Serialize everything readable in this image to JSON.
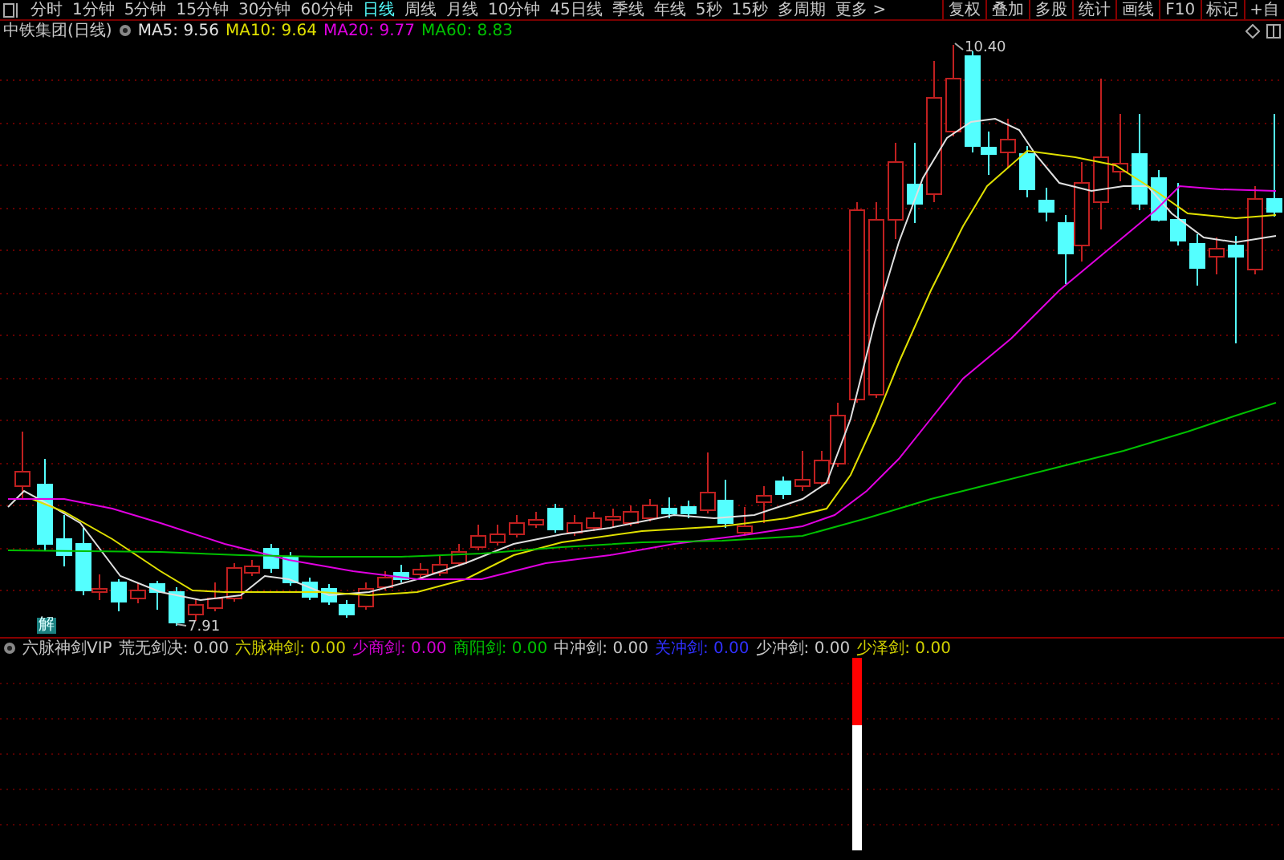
{
  "toolbar": {
    "periods": [
      {
        "label": "分时",
        "selected": false
      },
      {
        "label": "1分钟",
        "selected": false
      },
      {
        "label": "5分钟",
        "selected": false
      },
      {
        "label": "15分钟",
        "selected": false
      },
      {
        "label": "30分钟",
        "selected": false
      },
      {
        "label": "60分钟",
        "selected": false
      },
      {
        "label": "日线",
        "selected": true
      },
      {
        "label": "周线",
        "selected": false
      },
      {
        "label": "月线",
        "selected": false
      },
      {
        "label": "10分钟",
        "selected": false
      },
      {
        "label": "45日线",
        "selected": false
      },
      {
        "label": "季线",
        "selected": false
      },
      {
        "label": "年线",
        "selected": false
      },
      {
        "label": "5秒",
        "selected": false
      },
      {
        "label": "15秒",
        "selected": false
      },
      {
        "label": "多周期",
        "selected": false
      },
      {
        "label": "更多 >",
        "selected": false
      }
    ],
    "buttons": [
      "复权",
      "叠加",
      "多股",
      "统计",
      "画线",
      "F10",
      "标记",
      "+自"
    ]
  },
  "legend": {
    "title": "中铁集团(日线)",
    "indicators": [
      {
        "label": "MA5: 9.56",
        "color": "#e0e0e0"
      },
      {
        "label": "MA10: 9.64",
        "color": "#e0e000"
      },
      {
        "label": "MA20: 9.77",
        "color": "#e000e0"
      },
      {
        "label": "MA60: 8.83",
        "color": "#00c000"
      }
    ]
  },
  "chart": {
    "high_label": "10.40",
    "low_label": "7.91",
    "badge": "解"
  },
  "indicator_panel": {
    "title": "六脉神剑VIP",
    "values": [
      {
        "label": "荒无剑决: 0.00",
        "color": "#c8c8c8"
      },
      {
        "label": "六脉神剑: 0.00",
        "color": "#d0d000"
      },
      {
        "label": "少商剑: 0.00",
        "color": "#d000d0"
      },
      {
        "label": "商阳剑: 0.00",
        "color": "#00c000"
      },
      {
        "label": "中冲剑: 0.00",
        "color": "#c8c8c8"
      },
      {
        "label": "关冲剑: 0.00",
        "color": "#3030ff"
      },
      {
        "label": "少冲剑: 0.00",
        "color": "#c8c8c8"
      },
      {
        "label": "少泽剑: 0.00",
        "color": "#d0d000"
      }
    ]
  }
}
